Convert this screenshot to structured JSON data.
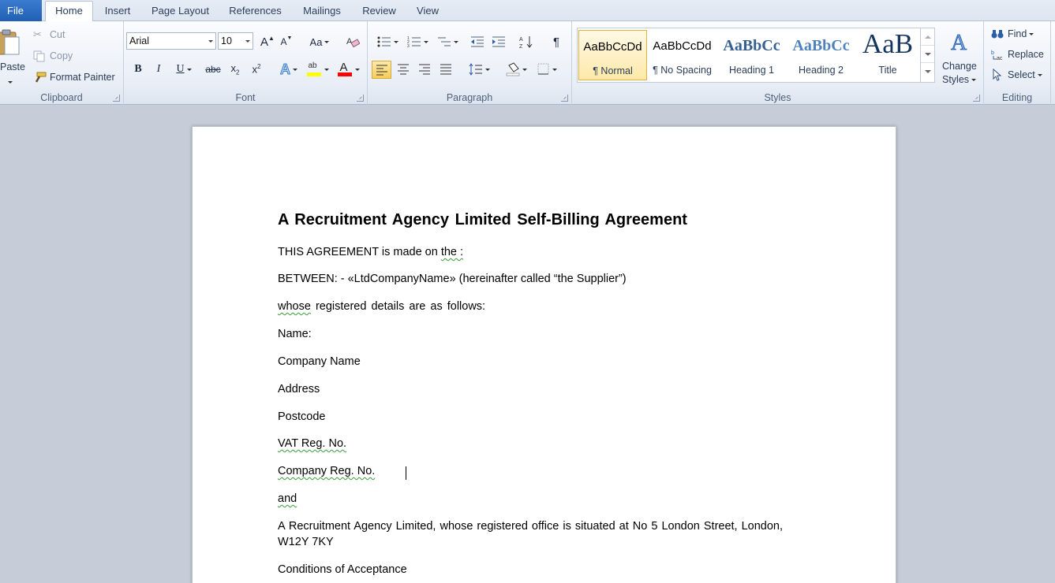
{
  "tabs": {
    "file": "File",
    "items": [
      "Home",
      "Insert",
      "Page Layout",
      "References",
      "Mailings",
      "Review",
      "View"
    ],
    "active": "Home"
  },
  "clipboard": {
    "paste": "Paste",
    "cut": "Cut",
    "copy": "Copy",
    "format_painter": "Format Painter",
    "label": "Clipboard"
  },
  "font": {
    "family": "Arial",
    "size": "10",
    "label": "Font",
    "bold": "B",
    "italic": "I",
    "underline": "U",
    "strike": "abc",
    "grow": "A",
    "shrink": "A",
    "change_case": "Aa",
    "highlight_color": "#ffff00",
    "font_color": "#ff0000"
  },
  "paragraph": {
    "label": "Paragraph",
    "show_marks": "¶"
  },
  "styles": {
    "label": "Styles",
    "tiles": [
      {
        "sample": "AaBbCcDd",
        "name": "¶ Normal"
      },
      {
        "sample": "AaBbCcDd",
        "name": "¶ No Spacing"
      },
      {
        "sample": "AaBbCc",
        "name": "Heading 1"
      },
      {
        "sample": "AaBbCc",
        "name": "Heading 2"
      },
      {
        "sample": "AaB",
        "name": "Title"
      }
    ],
    "change_styles_line1": "Change",
    "change_styles_line2": "Styles"
  },
  "editing": {
    "label": "Editing",
    "find": "Find",
    "replace": "Replace",
    "select": "Select"
  },
  "document": {
    "title": "A Recruitment Agency Limited Self-Billing Agreement",
    "p1_a": "THIS AGREEMENT is made on ",
    "p1_b": "the :",
    "p2": "BETWEEN: - «LtdCompanyName» (hereinafter called “the Supplier”)",
    "p3_a": "whose",
    "p3_b": " registered details  are as follows:",
    "p4": "Name:",
    "p5": "Company Name",
    "p6": "Address",
    "p7": "Postcode",
    "p8": "VAT Reg. No.",
    "p9": "Company Reg. No.",
    "p10": "and",
    "p11_line1": "A Recruitment Agency Limited, whose registered office is situated at No 5 London Street, London,",
    "p11_line2": "W12Y 7KY",
    "p12": "Conditions  of Acceptance"
  }
}
